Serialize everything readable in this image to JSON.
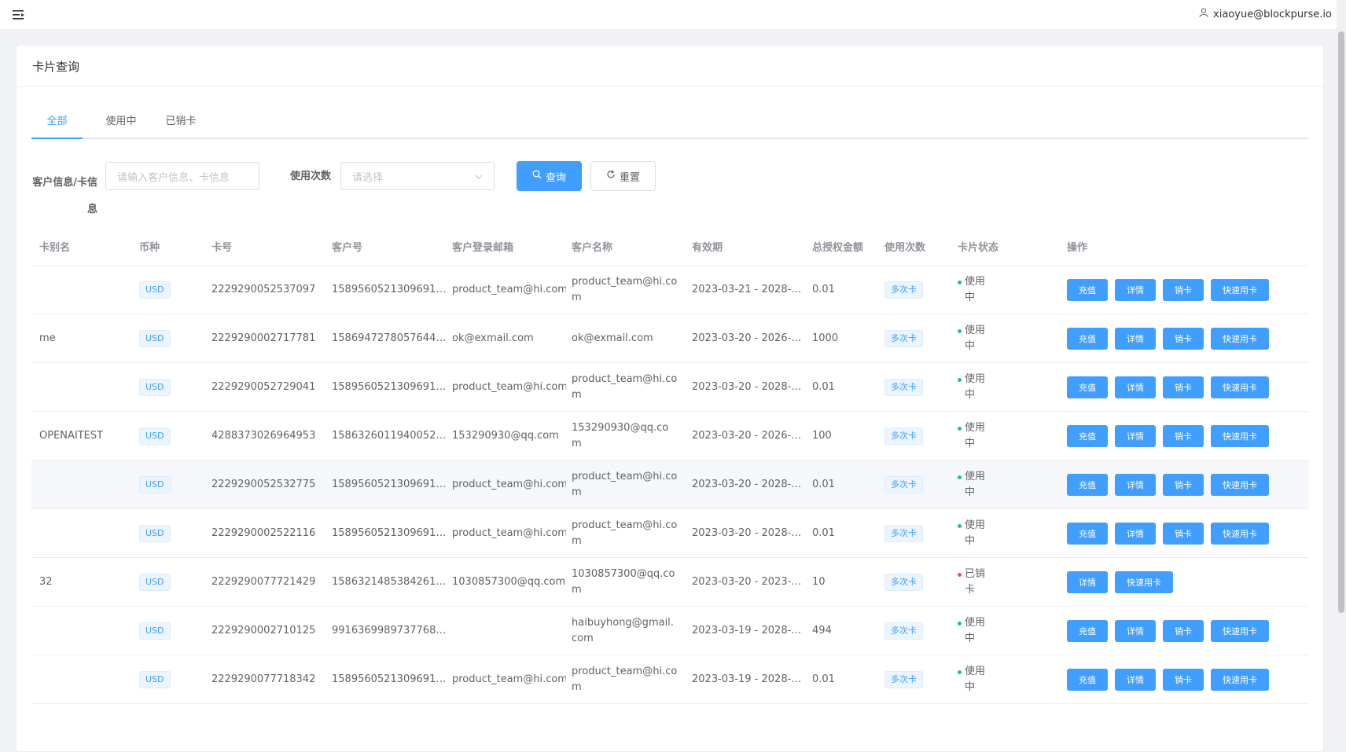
{
  "header": {
    "user": "xiaoyue@blockpurse.io"
  },
  "card": {
    "title": "卡片查询"
  },
  "tabs": [
    {
      "label": "全部"
    },
    {
      "label": "使用中"
    },
    {
      "label": "已销卡"
    }
  ],
  "filters": {
    "customer_label": "客户信息/卡信息",
    "customer_placeholder": "请输入客户信息、卡信息",
    "usage_label": "使用次数",
    "usage_placeholder": "请选择",
    "search_label": "查询",
    "reset_label": "重置"
  },
  "table": {
    "headers": [
      "卡别名",
      "币种",
      "卡号",
      "客户号",
      "客户登录邮箱",
      "客户名称",
      "有效期",
      "总授权金额",
      "使用次数",
      "卡片状态",
      "操作"
    ],
    "actions": {
      "recharge": "充值",
      "detail": "详情",
      "cancel": "销卡",
      "quick": "快速用卡"
    },
    "rows": [
      {
        "alias": "",
        "currency": "USD",
        "card_no": "2229290052537097",
        "cust_no": "1589560521309691…",
        "email": "product_team@hi.com",
        "name": "product_team@hi.com",
        "validity": "2023-03-21 - 2028-…",
        "amount": "0.01",
        "usage": "多次卡",
        "status": "使用中",
        "status_color": "#13ce66"
      },
      {
        "alias": "me",
        "currency": "USD",
        "card_no": "2229290002717781",
        "cust_no": "1586947278057644…",
        "email": "ok@exmail.com",
        "name": "ok@exmail.com",
        "validity": "2023-03-20 - 2026-…",
        "amount": "1000",
        "usage": "多次卡",
        "status": "使用中",
        "status_color": "#13ce66"
      },
      {
        "alias": "",
        "currency": "USD",
        "card_no": "2229290052729041",
        "cust_no": "1589560521309691…",
        "email": "product_team@hi.com",
        "name": "product_team@hi.com",
        "validity": "2023-03-20 - 2028-…",
        "amount": "0.01",
        "usage": "多次卡",
        "status": "使用中",
        "status_color": "#13ce66"
      },
      {
        "alias": "OPENAITEST",
        "currency": "USD",
        "card_no": "4288373026964953",
        "cust_no": "1586326011940052…",
        "email": "153290930@qq.com",
        "name": "153290930@qq.com",
        "validity": "2023-03-20 - 2026-…",
        "amount": "100",
        "usage": "多次卡",
        "status": "使用中",
        "status_color": "#13ce66"
      },
      {
        "alias": "",
        "currency": "USD",
        "card_no": "2229290052532775",
        "cust_no": "1589560521309691…",
        "email": "product_team@hi.com",
        "name": "product_team@hi.com",
        "validity": "2023-03-20 - 2028-…",
        "amount": "0.01",
        "usage": "多次卡",
        "status": "使用中",
        "status_color": "#13ce66"
      },
      {
        "alias": "",
        "currency": "USD",
        "card_no": "2229290002522116",
        "cust_no": "1589560521309691…",
        "email": "product_team@hi.com",
        "name": "product_team@hi.com",
        "validity": "2023-03-20 - 2028-…",
        "amount": "0.01",
        "usage": "多次卡",
        "status": "使用中",
        "status_color": "#13ce66"
      },
      {
        "alias": "32",
        "currency": "USD",
        "card_no": "2229290077721429",
        "cust_no": "1586321485384261…",
        "email": "1030857300@qq.com",
        "name": "1030857300@qq.com",
        "validity": "2023-03-20 - 2023-…",
        "amount": "10",
        "usage": "多次卡",
        "status": "已销卡",
        "status_color": "#ff4949"
      },
      {
        "alias": "",
        "currency": "USD",
        "card_no": "2229290002710125",
        "cust_no": "9916369989737768…",
        "email": "",
        "name": "haibuyhong@gmail.com",
        "validity": "2023-03-19 - 2028-…",
        "amount": "494",
        "usage": "多次卡",
        "status": "使用中",
        "status_color": "#13ce66"
      },
      {
        "alias": "",
        "currency": "USD",
        "card_no": "2229290077718342",
        "cust_no": "1589560521309691…",
        "email": "product_team@hi.com",
        "name": "product_team@hi.com",
        "validity": "2023-03-19 - 2028-…",
        "amount": "0.01",
        "usage": "多次卡",
        "status": "使用中",
        "status_color": "#13ce66"
      }
    ]
  }
}
